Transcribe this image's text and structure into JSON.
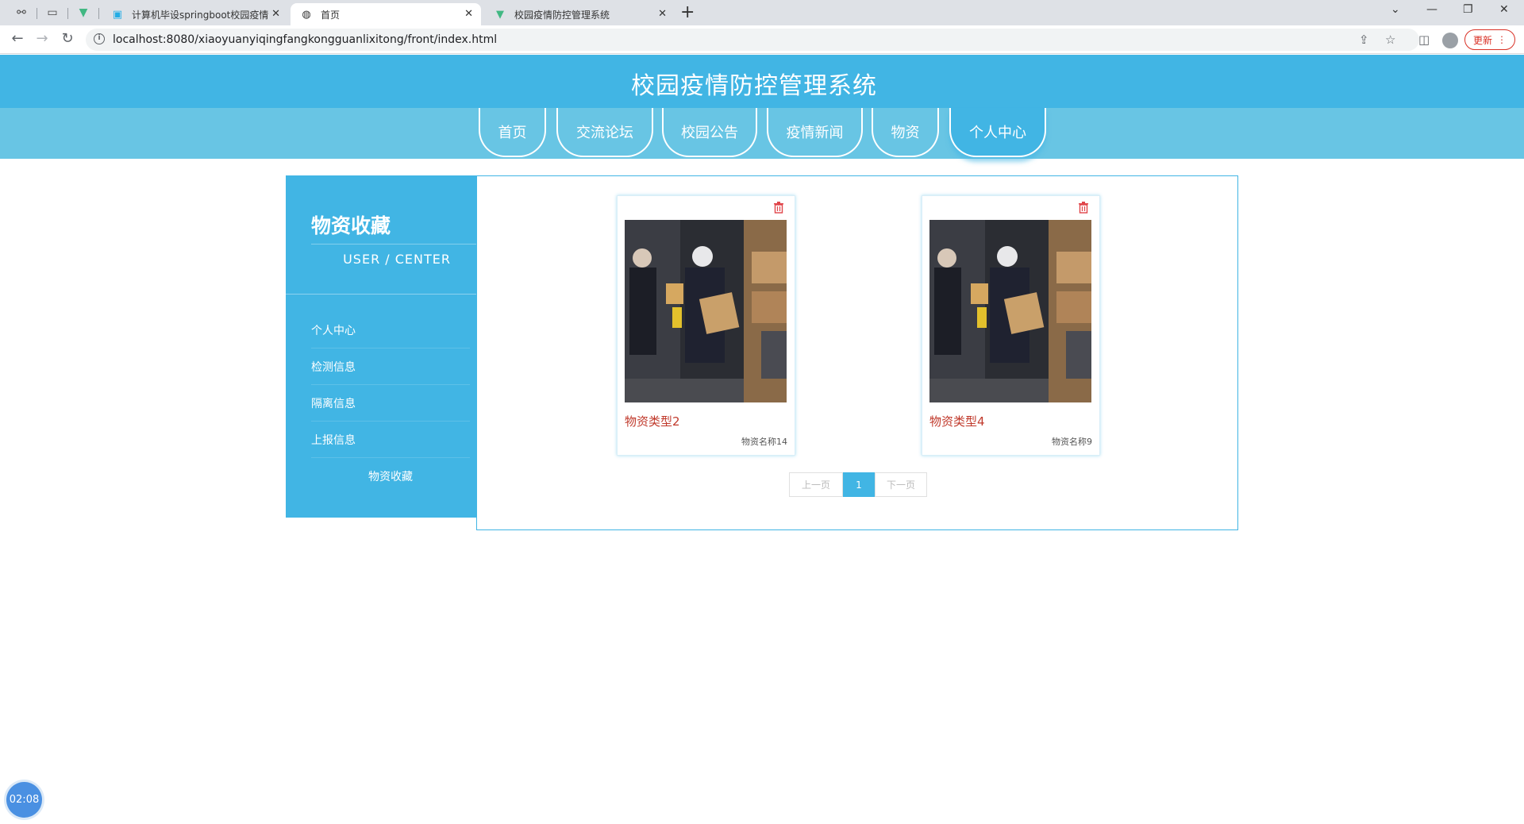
{
  "browser": {
    "tabs": [
      {
        "label": "计算机毕设springboot校园疫情",
        "icon": "bilibili-icon",
        "active": false
      },
      {
        "label": "首页",
        "icon": "globe-icon",
        "active": true
      },
      {
        "label": "校园疫情防控管理系统",
        "icon": "vue-icon",
        "active": false
      }
    ],
    "url": "localhost:8080/xiaoyuanyiqingfangkongguanlixitong/front/index.html",
    "update_label": "更新"
  },
  "site": {
    "title": "校园疫情防控管理系统",
    "nav": [
      {
        "label": "首页",
        "active": false
      },
      {
        "label": "交流论坛",
        "active": false
      },
      {
        "label": "校园公告",
        "active": false
      },
      {
        "label": "疫情新闻",
        "active": false
      },
      {
        "label": "物资",
        "active": false
      },
      {
        "label": "个人中心",
        "active": true
      }
    ]
  },
  "sidebar": {
    "title": "物资收藏",
    "subtitle": "USER / CENTER",
    "items": [
      {
        "label": "个人中心",
        "active": false
      },
      {
        "label": "检测信息",
        "active": false
      },
      {
        "label": "隔离信息",
        "active": false
      },
      {
        "label": "上报信息",
        "active": false
      },
      {
        "label": "物资收藏",
        "active": true
      }
    ]
  },
  "cards": [
    {
      "type": "物资类型2",
      "name": "物资名称14"
    },
    {
      "type": "物资类型4",
      "name": "物资名称9"
    }
  ],
  "pager": {
    "prev": "上一页",
    "current": "1",
    "next": "下一页"
  },
  "timer": "02:08",
  "colors": {
    "primary": "#41b5e4",
    "nav_band": "#68c5e4",
    "card_type": "#c0392b"
  }
}
